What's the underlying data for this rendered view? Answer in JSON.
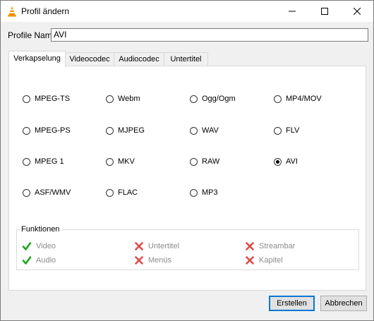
{
  "window": {
    "title": "Profil ändern"
  },
  "profile": {
    "label": "Profile Name",
    "value": "AVI"
  },
  "tabs": [
    {
      "label": "Verkapselung",
      "active": true
    },
    {
      "label": "Videocodec",
      "active": false
    },
    {
      "label": "Audiocodec",
      "active": false
    },
    {
      "label": "Untertitel",
      "active": false
    }
  ],
  "containers": [
    {
      "label": "MPEG-TS",
      "selected": false
    },
    {
      "label": "Webm",
      "selected": false
    },
    {
      "label": "Ogg/Ogm",
      "selected": false
    },
    {
      "label": "MP4/MOV",
      "selected": false
    },
    {
      "label": "MPEG-PS",
      "selected": false
    },
    {
      "label": "MJPEG",
      "selected": false
    },
    {
      "label": "WAV",
      "selected": false
    },
    {
      "label": "FLV",
      "selected": false
    },
    {
      "label": "MPEG 1",
      "selected": false
    },
    {
      "label": "MKV",
      "selected": false
    },
    {
      "label": "RAW",
      "selected": false
    },
    {
      "label": "AVI",
      "selected": true
    },
    {
      "label": "ASF/WMV",
      "selected": false
    },
    {
      "label": "FLAC",
      "selected": false
    },
    {
      "label": "MP3",
      "selected": false
    }
  ],
  "features": {
    "title": "Funktionen",
    "items": [
      {
        "label": "Video",
        "supported": true
      },
      {
        "label": "Audio",
        "supported": true
      },
      {
        "label": "Untertitel",
        "supported": false
      },
      {
        "label": "Menüs",
        "supported": false
      },
      {
        "label": "Streambar",
        "supported": false
      },
      {
        "label": "Kapitel",
        "supported": false
      }
    ]
  },
  "buttons": {
    "create": "Erstellen",
    "cancel": "Abbrechen"
  },
  "colors": {
    "check": "#1fa51f",
    "cross": "#e04a4a",
    "accent": "#0078d7"
  }
}
